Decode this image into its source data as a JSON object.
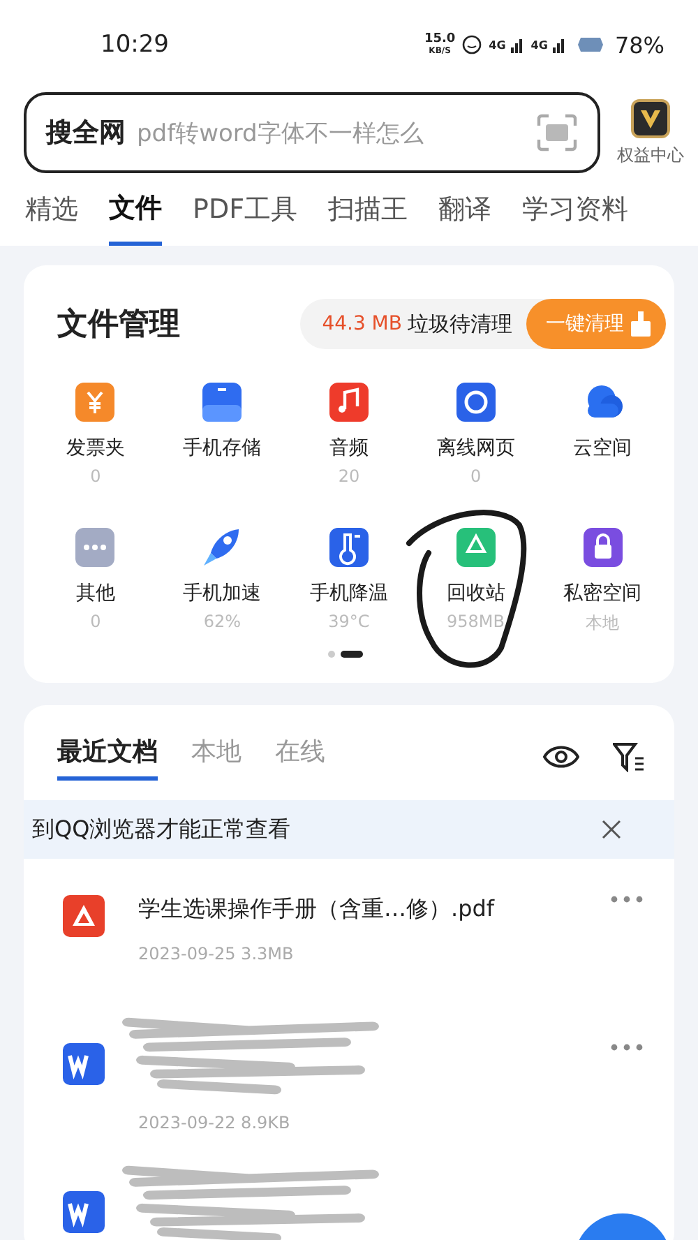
{
  "status_bar": {
    "time": "10:29",
    "net_speed_value": "15.0",
    "net_speed_unit": "KB/S",
    "networks": [
      "4G",
      "4G"
    ],
    "battery": "78%"
  },
  "search": {
    "label": "搜全网",
    "placeholder": "pdf转word字体不一样怎么"
  },
  "vip": {
    "label": "权益中心"
  },
  "tabs": [
    {
      "label": "精选",
      "selected": false
    },
    {
      "label": "文件",
      "selected": true
    },
    {
      "label": "PDF工具",
      "selected": false
    },
    {
      "label": "扫描王",
      "selected": false
    },
    {
      "label": "翻译",
      "selected": false
    },
    {
      "label": "学习资料",
      "selected": false
    }
  ],
  "file_manager": {
    "title": "文件管理",
    "junk_size": "44.3 MB",
    "junk_label": "垃圾待清理",
    "clean_button": "一键清理",
    "items": [
      {
        "kind": "invoice",
        "label": "发票夹",
        "count": "0"
      },
      {
        "kind": "storage",
        "label": "手机存储"
      },
      {
        "kind": "audio",
        "label": "音频",
        "count": "20"
      },
      {
        "kind": "web",
        "label": "离线网页",
        "count": "0"
      },
      {
        "kind": "cloud",
        "label": "云空间"
      },
      {
        "kind": "other",
        "label": "其他",
        "count": "0"
      },
      {
        "kind": "boost",
        "label": "手机加速",
        "count": "62%"
      },
      {
        "kind": "cool",
        "label": "手机降温",
        "count": "39°C"
      },
      {
        "kind": "recycle",
        "label": "回收站",
        "count": "958MB",
        "circled": true
      },
      {
        "kind": "private",
        "label": "私密空间",
        "count": "本地"
      }
    ],
    "pages": [
      {
        "selected": false
      },
      {
        "selected": true
      }
    ]
  },
  "recent": {
    "tabs": [
      {
        "label": "最近文档",
        "selected": true
      },
      {
        "label": "本地",
        "selected": false
      },
      {
        "label": "在线",
        "selected": false
      }
    ],
    "notice": "到QQ浏览器才能正常查看",
    "files": [
      {
        "kind": "pdf",
        "name": "学生选课操作手册（含重…修）.pdf",
        "meta": "2023-09-25  3.3MB",
        "obscured": false
      },
      {
        "kind": "word",
        "meta": "2023-09-22  8.9KB",
        "obscured": true
      },
      {
        "kind": "word",
        "obscured": true
      }
    ]
  }
}
